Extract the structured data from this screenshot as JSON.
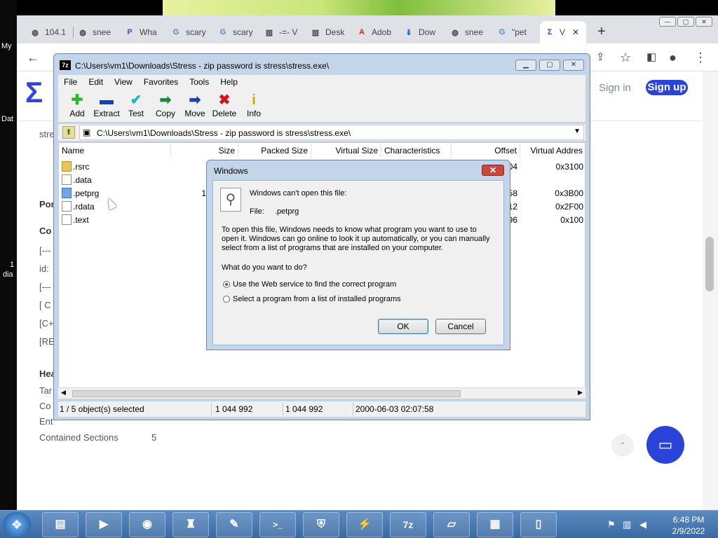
{
  "desktop": {
    "icon_labels": [
      "My",
      "Dat",
      "1",
      "dia"
    ]
  },
  "browser": {
    "tabs": [
      {
        "title": "104.1",
        "icon": "globe-icon",
        "glyph": "◍"
      },
      {
        "title": "snee",
        "icon": "globe-icon",
        "glyph": "◍"
      },
      {
        "title": "Wha",
        "icon": "p-logo-icon",
        "glyph": "P"
      },
      {
        "title": "scary",
        "icon": "google-icon",
        "glyph": "G"
      },
      {
        "title": "scary",
        "icon": "google-icon",
        "glyph": "G"
      },
      {
        "title": "-=- V",
        "icon": "museum-icon",
        "glyph": "▥"
      },
      {
        "title": "Desk",
        "icon": "museum-icon",
        "glyph": "▥"
      },
      {
        "title": "Adob",
        "icon": "adobe-icon",
        "glyph": "A"
      },
      {
        "title": "Dow",
        "icon": "download-icon",
        "glyph": "⬇"
      },
      {
        "title": "snee",
        "icon": "globe-icon",
        "glyph": "◍"
      },
      {
        "title": "\"pet",
        "icon": "google-icon",
        "glyph": "G"
      },
      {
        "title": "V",
        "icon": "sigma-icon",
        "glyph": "Σ"
      }
    ],
    "new_tab": "+",
    "close_tab": "✕",
    "page": {
      "signin": "Sign in",
      "signup": "Sign up",
      "left_fragments": [
        "stre",
        "Por",
        "Co",
        "[---",
        "id:",
        "[---",
        "[ C",
        "[C+",
        "[RE",
        "Hea",
        "Tar",
        "Co",
        "Ent"
      ],
      "contained_sections_label": "Contained Sections",
      "contained_sections_value": "5"
    }
  },
  "zip": {
    "title": "C:\\Users\\vm1\\Downloads\\Stress - zip password is stress\\stress.exe\\",
    "menu": [
      "File",
      "Edit",
      "View",
      "Favorites",
      "Tools",
      "Help"
    ],
    "tools": [
      {
        "label": "Add",
        "icon": "plus-icon",
        "glyph": "✚",
        "color": "#2eb82e"
      },
      {
        "label": "Extract",
        "icon": "minus-icon",
        "glyph": "▬",
        "color": "#1a3fb0"
      },
      {
        "label": "Test",
        "icon": "check-icon",
        "glyph": "✔",
        "color": "#1fb5c9"
      },
      {
        "label": "Copy",
        "icon": "copy-arrow-icon",
        "glyph": "➡",
        "color": "#1a8a3a"
      },
      {
        "label": "Move",
        "icon": "move-arrow-icon",
        "glyph": "➡",
        "color": "#1a3fb0"
      },
      {
        "label": "Delete",
        "icon": "delete-x-icon",
        "glyph": "✖",
        "color": "#d4141a"
      },
      {
        "label": "Info",
        "icon": "info-icon",
        "glyph": "i",
        "color": "#c9a800"
      }
    ],
    "address": "C:\\Users\\vm1\\Downloads\\Stress - zip password is stress\\stress.exe\\",
    "columns": [
      "Name",
      "Size",
      "Packed Size",
      "Virtual Size",
      "Characteristics",
      "Offset",
      "Virtual Addres"
    ],
    "rows": [
      {
        "name": ".rsrc",
        "type": "folder",
        "offset": "04",
        "vaddr": "0x3100"
      },
      {
        "name": ".data",
        "type": "file",
        "offset": "",
        "vaddr": ""
      },
      {
        "name": ".petprg",
        "type": "file-selected",
        "offset": "58",
        "vaddr": "0x3B00",
        "size_frag": "1"
      },
      {
        "name": ".rdata",
        "type": "file",
        "offset": "12",
        "vaddr": "0x2F00"
      },
      {
        "name": ".text",
        "type": "file",
        "offset": "96",
        "vaddr": "0x100"
      }
    ],
    "status": {
      "selected": "1 / 5 object(s) selected",
      "size": "1 044 992",
      "packed": "1 044 992",
      "date": "2000-06-03 02:07:58"
    }
  },
  "dialog": {
    "title": "Windows",
    "close": "✕",
    "heading": "Windows can't open this file:",
    "file_label": "File:",
    "file_name": ".petprg",
    "explanation_1": "To open this file, Windows needs to know what program you want to use to",
    "explanation_2": "open it. Windows can go online to look it up automatically, or you can manually",
    "explanation_3": "select from a list of programs that are installed on your computer.",
    "question": "What do you want to do?",
    "option_web": "Use the Web service to find the correct program",
    "option_list": "Select a program from a list of installed programs",
    "selected_option": "web",
    "ok": "OK",
    "cancel": "Cancel"
  },
  "taskbar": {
    "apps": [
      {
        "name": "explorer",
        "icon": "folder-icon",
        "glyph": "▤"
      },
      {
        "name": "media-player",
        "icon": "media-player-icon",
        "glyph": "▶"
      },
      {
        "name": "chrome",
        "icon": "chrome-icon",
        "glyph": "◉"
      },
      {
        "name": "game",
        "icon": "game-icon",
        "glyph": "♜"
      },
      {
        "name": "notepad-plus",
        "icon": "notepad-icon",
        "glyph": "✎"
      },
      {
        "name": "cmd",
        "icon": "terminal-icon",
        "glyph": ">_"
      },
      {
        "name": "network",
        "icon": "network-icon",
        "glyph": "⛨"
      },
      {
        "name": "tool",
        "icon": "plug-icon",
        "glyph": "⚡"
      },
      {
        "name": "7zip",
        "icon": "7zip-icon",
        "glyph": "7z"
      },
      {
        "name": "notes",
        "icon": "notes-icon",
        "glyph": "▱"
      },
      {
        "name": "control-panel",
        "icon": "control-panel-icon",
        "glyph": "▦"
      },
      {
        "name": "document",
        "icon": "document-icon",
        "glyph": "▯"
      }
    ],
    "time": "6:48 PM",
    "date": "2/9/2022"
  }
}
